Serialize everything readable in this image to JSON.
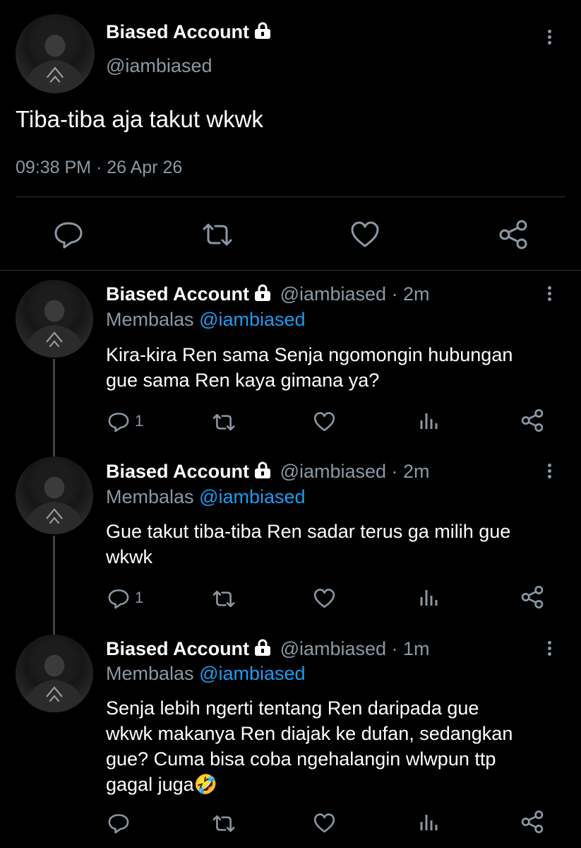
{
  "main_tweet": {
    "display_name": "Biased Account",
    "handle": "@iambiased",
    "text": "Tiba-tiba aja takut wkwk",
    "timestamp": "09:38 PM · 26 Apr 26",
    "actions": [
      "reply-icon",
      "retweet-icon",
      "like-icon",
      "share-icon"
    ]
  },
  "replies": [
    {
      "display_name": "Biased Account",
      "handle_time": "@iambiased · 2m",
      "replying_prefix": "Membalas",
      "replying_to": "@iambiased",
      "text_line1": "Kira-kira Ren sama Senja ngomongin hubungan",
      "text_line2": "gue sama Ren kaya gimana ya?",
      "reply_count": "1"
    },
    {
      "display_name": "Biased Account",
      "handle_time": "@iambiased · 2m",
      "replying_prefix": "Membalas",
      "replying_to": "@iambiased",
      "text_line1": "Gue takut tiba-tiba Ren sadar terus ga milih gue",
      "text_line2": "wkwk",
      "reply_count": "1"
    },
    {
      "display_name": "Biased Account",
      "handle_time": "@iambiased · 1m",
      "replying_prefix": "Membalas",
      "replying_to": "@iambiased",
      "text_line1": "Senja lebih ngerti tentang Ren daripada gue",
      "text_line2": "wkwk makanya Ren diajak ke dufan, sedangkan",
      "text_line3": "gue? Cuma bisa coba ngehalangin wlwpun ttp",
      "text_line4": "gagal juga🤣",
      "reply_count": ""
    }
  ],
  "colors": {
    "background": "#000000",
    "text": "#ffffff",
    "secondary": "#8b98a5",
    "link": "#1d9bf0",
    "divider": "#2f3336"
  }
}
